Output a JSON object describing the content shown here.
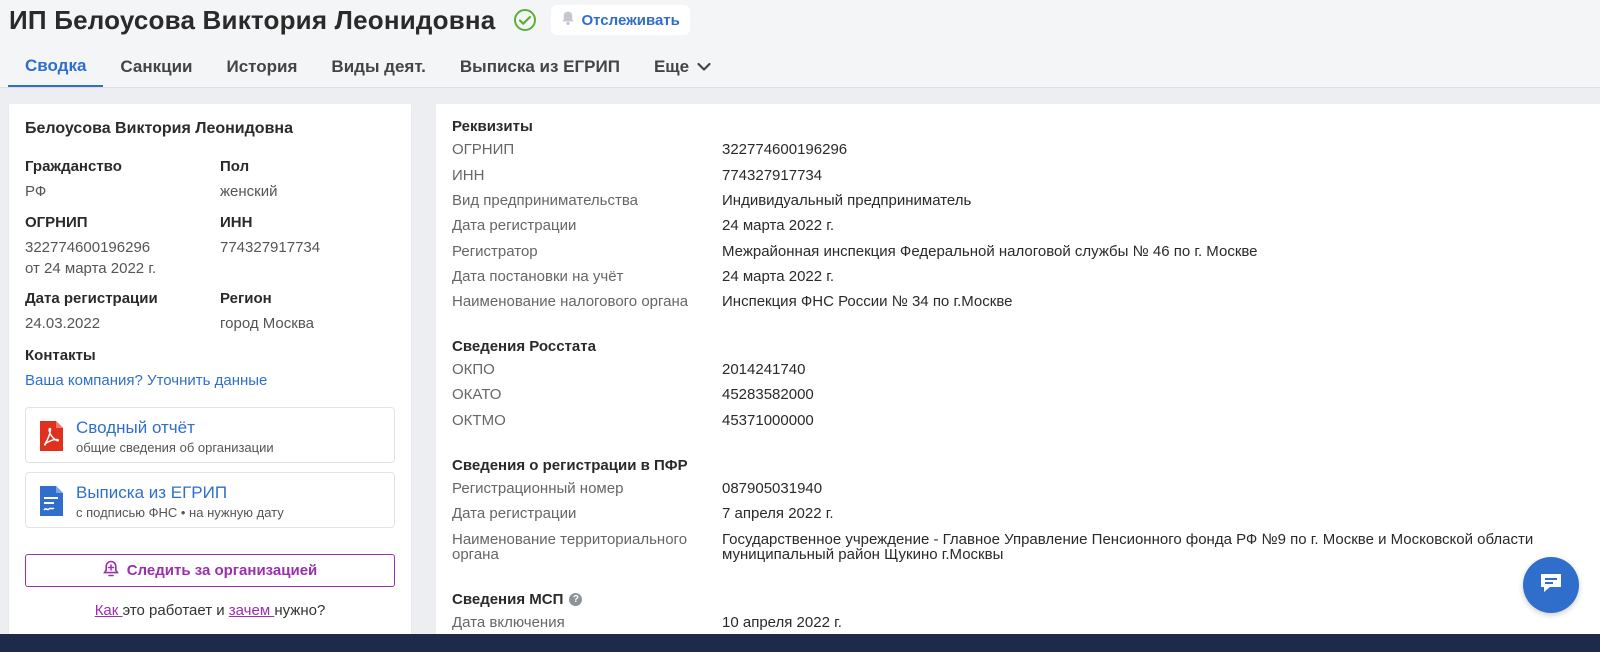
{
  "header": {
    "title": "ИП Белоусова Виктория Леонидовна",
    "track_label": "Отслеживать"
  },
  "tabs": [
    {
      "label": "Сводка",
      "active": true
    },
    {
      "label": "Санкции"
    },
    {
      "label": "История"
    },
    {
      "label": "Виды деят."
    },
    {
      "label": "Выписка из ЕГРИП"
    },
    {
      "label": "Еще"
    }
  ],
  "left": {
    "name": "Белоусова Виктория Леонидовна",
    "citizenship_label": "Гражданство",
    "citizenship": "РФ",
    "sex_label": "Пол",
    "sex": "женский",
    "ogrnip_label": "ОГРНИП",
    "ogrnip": "322774600196296",
    "ogrnip_date": "от 24 марта 2022 г.",
    "inn_label": "ИНН",
    "inn": "774327917734",
    "reg_date_label": "Дата регистрации",
    "reg_date": "24.03.2022",
    "region_label": "Регион",
    "region": "город Москва",
    "contacts_label": "Контакты",
    "contacts_link": "Ваша компания? Уточнить данные",
    "report_title": "Сводный отчёт",
    "report_sub": "общие сведения об организации",
    "extract_title": "Выписка из ЕГРИП",
    "extract_sub": "с подписью ФНС • на нужную дату",
    "follow_label": "Следить за организацией",
    "how_link": "Как ",
    "how_mid": "это работает и ",
    "why_link": "зачем ",
    "how_end": "нужно?"
  },
  "requisites": {
    "title": "Реквизиты",
    "rows": [
      {
        "k": "ОГРНИП",
        "v": "322774600196296"
      },
      {
        "k": "ИНН",
        "v": "774327917734"
      },
      {
        "k": "Вид предпринимательства",
        "v": "Индивидуальный предприниматель"
      },
      {
        "k": "Дата регистрации",
        "v": "24 марта 2022 г."
      },
      {
        "k": "Регистратор",
        "v": "Межрайонная инспекция Федеральной налоговой службы № 46 по г. Москве"
      },
      {
        "k": "Дата постановки на учёт",
        "v": "24 марта 2022 г."
      },
      {
        "k": "Наименование налогового органа",
        "v": "Инспекция ФНС России № 34 по г.Москве"
      }
    ]
  },
  "rosstat": {
    "title": "Сведения Росстата",
    "rows": [
      {
        "k": "ОКПО",
        "v": "2014241740"
      },
      {
        "k": "ОКАТО",
        "v": "45283582000"
      },
      {
        "k": "ОКТМО",
        "v": "45371000000"
      }
    ]
  },
  "pfr": {
    "title": "Сведения о регистрации в ПФР",
    "rows": [
      {
        "k": "Регистрационный номер",
        "v": "087905031940"
      },
      {
        "k": "Дата регистрации",
        "v": "7 апреля 2022 г."
      }
    ],
    "org_k1": "Наименование территориального",
    "org_k2": "органа",
    "org_v1": "Государственное учреждение - Главное Управление Пенсионного фонда РФ №9 по г. Москве и Московской области",
    "org_v2": "муниципальный район Щукино г.Москвы"
  },
  "msp": {
    "title": "Сведения МСП",
    "help": "?",
    "rows": [
      {
        "k": "Дата включения",
        "v": "10 апреля 2022 г."
      }
    ]
  },
  "colors": {
    "accent": "#2f6fcb",
    "follow": "#9b2fae",
    "verified": "#5bb035",
    "pdf": "#e0301e"
  }
}
